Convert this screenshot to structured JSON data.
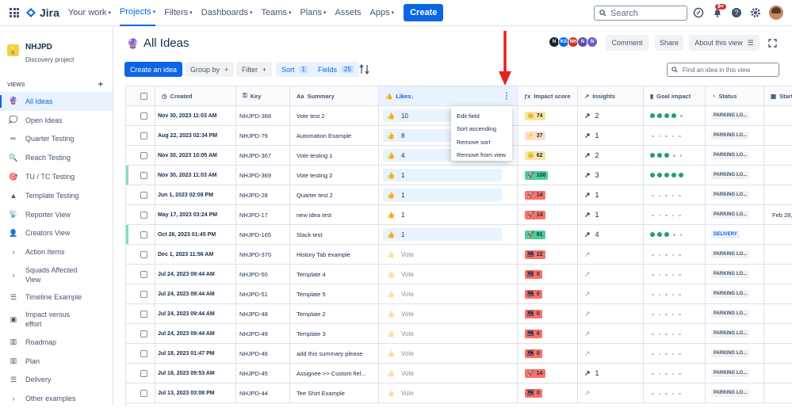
{
  "topnav": {
    "product": "Jira",
    "items": [
      {
        "label": "Your work",
        "dropdown": true
      },
      {
        "label": "Projects",
        "dropdown": true,
        "active": true
      },
      {
        "label": "Filters",
        "dropdown": true
      },
      {
        "label": "Dashboards",
        "dropdown": true
      },
      {
        "label": "Teams",
        "dropdown": true
      },
      {
        "label": "Plans",
        "dropdown": true
      },
      {
        "label": "Assets",
        "dropdown": false
      },
      {
        "label": "Apps",
        "dropdown": true
      }
    ],
    "create_label": "Create",
    "search_placeholder": "Search",
    "notifications_badge": "9+"
  },
  "sidebar": {
    "project_name": "NHJPD",
    "project_type": "Discovery project",
    "views_heading": "VIEWS",
    "items": [
      {
        "label": "All Ideas",
        "icon": "crystal-ball-icon",
        "glyph": "🔮",
        "active": true
      },
      {
        "label": "Open Ideas",
        "icon": "thought-icon",
        "glyph": "💭"
      },
      {
        "label": "Quarter Testing",
        "icon": "pencil-icon",
        "glyph": "✏"
      },
      {
        "label": "Reach Testing",
        "icon": "magnifier-icon",
        "glyph": "🔍"
      },
      {
        "label": "TU / TC Testing",
        "icon": "target-icon",
        "glyph": "🎯"
      },
      {
        "label": "Template Testing",
        "icon": "cone-icon",
        "glyph": "▲"
      },
      {
        "label": "Reporter View",
        "icon": "satellite-icon",
        "glyph": "📡"
      },
      {
        "label": "Creators View",
        "icon": "person-icon",
        "glyph": "👤"
      },
      {
        "label": "Action Items",
        "icon": "chevron-right-icon",
        "glyph": "›"
      },
      {
        "label": "Squads Affected View",
        "icon": "chevron-right-icon",
        "glyph": "›"
      },
      {
        "label": "Timeline Example",
        "icon": "timeline-icon",
        "glyph": "☰"
      },
      {
        "label": "Impact versus effort",
        "icon": "matrix-icon",
        "glyph": "▣"
      },
      {
        "label": "Roadmap",
        "icon": "board-icon",
        "glyph": "▥"
      },
      {
        "label": "Plan",
        "icon": "board-icon",
        "glyph": "▥"
      },
      {
        "label": "Delivery",
        "icon": "list-icon",
        "glyph": "☰"
      },
      {
        "label": "Other examples",
        "icon": "chevron-right-icon",
        "glyph": "›"
      }
    ]
  },
  "header": {
    "title": "All Ideas",
    "avatars": [
      {
        "initial": "N",
        "color": "#1d2125"
      },
      {
        "initial": "KS",
        "color": "#0c66e4"
      },
      {
        "initial": "NH",
        "color": "#c9372c"
      },
      {
        "initial": "N",
        "color": "#5e4db2"
      },
      {
        "initial": "N",
        "color": "#6e5dc6"
      }
    ],
    "comment_label": "Comment",
    "share_label": "Share",
    "about_label": "About this view"
  },
  "toolbar": {
    "create_idea": "Create an idea",
    "group_by": "Group by",
    "filter": "Filter",
    "sort": "Sort",
    "sort_count": "1",
    "fields": "Fields",
    "fields_count": "25",
    "find_placeholder": "Find an idea in this view"
  },
  "columns": [
    "Created",
    "Key",
    "Summary",
    "Likes",
    "Impact score",
    "Insights",
    "Goal impact",
    "Status",
    "Start"
  ],
  "rows": [
    {
      "created": "Nov 30, 2023 11:03 AM",
      "key": "NHJPD-368",
      "summary": "Vote test 2",
      "likes": "10",
      "liked": true,
      "impact": "74",
      "impact_icon": "👑",
      "impact_color": "#f8e6a0",
      "insights": "2",
      "goal": 4,
      "status": "PARKING LO...",
      "start": "",
      "marked": false
    },
    {
      "created": "Aug 22, 2023 02:34 PM",
      "key": "NHJPD-79",
      "summary": "Automation Example",
      "likes": "8",
      "liked": true,
      "impact": "37",
      "impact_icon": "⚡",
      "impact_color": "#fedec8",
      "insights": "1",
      "goal": 0,
      "status": "PARKING LO...",
      "start": "",
      "marked": false
    },
    {
      "created": "Nov 30, 2023 10:05 AM",
      "key": "NHJPD-367",
      "summary": "Vote testing 1",
      "likes": "4",
      "liked": true,
      "impact": "62",
      "impact_icon": "👑",
      "impact_color": "#f8e6a0",
      "insights": "2",
      "goal": 3,
      "status": "PARKING LO...",
      "start": "",
      "marked": false
    },
    {
      "created": "Nov 30, 2023 11:03 AM",
      "key": "NHJPD-369",
      "summary": "Vote testing 2",
      "likes": "1",
      "liked": true,
      "impact": "100",
      "impact_icon": "🚀",
      "impact_color": "#4bce97",
      "insights": "3",
      "goal": 5,
      "status": "PARKING LO...",
      "start": "",
      "marked": true
    },
    {
      "created": "Jun 1, 2023 02:08 PM",
      "key": "NHJPD-28",
      "summary": "Quarter test 2",
      "likes": "1",
      "liked": true,
      "impact": "14",
      "impact_icon": "🚀",
      "impact_color": "#f87168",
      "insights": "1",
      "goal": 0,
      "status": "PARKING LO...",
      "start": "",
      "marked": false
    },
    {
      "created": "May 17, 2023 03:24 PM",
      "key": "NHJPD-17",
      "summary": "new idea test",
      "likes": "1",
      "liked": false,
      "impact": "14",
      "impact_icon": "🚀",
      "impact_color": "#f87168",
      "insights": "1",
      "goal": 0,
      "status": "PARKING LO...",
      "start": "Feb 28,",
      "marked": false
    },
    {
      "created": "Oct 26, 2023 01:45 PM",
      "key": "NHJPD-165",
      "summary": "Slack test",
      "likes": "1",
      "liked": true,
      "impact": "91",
      "impact_icon": "🚀",
      "impact_color": "#4bce97",
      "insights": "4",
      "goal": 3,
      "status": "DELIVERY",
      "start": "",
      "marked": true
    },
    {
      "created": "Dec 1, 2023 11:56 AM",
      "key": "NHJPD-370",
      "summary": "History Tab example",
      "likes": "Vote",
      "liked": false,
      "impact": "22",
      "impact_icon": "🗺",
      "impact_color": "#f87168",
      "insights": "",
      "goal": 0,
      "status": "PARKING LO...",
      "start": "",
      "marked": false
    },
    {
      "created": "Jul 24, 2023 09:44 AM",
      "key": "NHJPD-50",
      "summary": "Template 4",
      "likes": "Vote",
      "liked": false,
      "impact": "0",
      "impact_icon": "🗺",
      "impact_color": "#f87168",
      "insights": "",
      "goal": 0,
      "status": "PARKING LO...",
      "start": "",
      "marked": false
    },
    {
      "created": "Jul 24, 2023 09:44 AM",
      "key": "NHJPD-51",
      "summary": "Template 5",
      "likes": "Vote",
      "liked": false,
      "impact": "0",
      "impact_icon": "🗺",
      "impact_color": "#f87168",
      "insights": "",
      "goal": 0,
      "status": "PARKING LO...",
      "start": "",
      "marked": false
    },
    {
      "created": "Jul 24, 2023 09:44 AM",
      "key": "NHJPD-48",
      "summary": "Template 2",
      "likes": "Vote",
      "liked": false,
      "impact": "0",
      "impact_icon": "🗺",
      "impact_color": "#f87168",
      "insights": "",
      "goal": 0,
      "status": "PARKING LO...",
      "start": "",
      "marked": false
    },
    {
      "created": "Jul 24, 2023 09:44 AM",
      "key": "NHJPD-49",
      "summary": "Template 3",
      "likes": "Vote",
      "liked": false,
      "impact": "0",
      "impact_icon": "🗺",
      "impact_color": "#f87168",
      "insights": "",
      "goal": 0,
      "status": "PARKING LO...",
      "start": "",
      "marked": false
    },
    {
      "created": "Jul 18, 2023 01:47 PM",
      "key": "NHJPD-46",
      "summary": "add this summary please",
      "likes": "Vote",
      "liked": false,
      "impact": "0",
      "impact_icon": "🗺",
      "impact_color": "#f87168",
      "insights": "",
      "goal": 0,
      "status": "PARKING LO...",
      "start": "",
      "marked": false
    },
    {
      "created": "Jul 18, 2023 09:53 AM",
      "key": "NHJPD-45",
      "summary": "Assignee >> Custom fiel...",
      "likes": "Vote",
      "liked": false,
      "impact": "14",
      "impact_icon": "🚀",
      "impact_color": "#f87168",
      "insights": "1",
      "goal": 0,
      "status": "PARKING LO...",
      "start": "",
      "marked": false
    },
    {
      "created": "Jul 13, 2023 03:08 PM",
      "key": "NHJPD-44",
      "summary": "Tee Shirt Example",
      "likes": "Vote",
      "liked": false,
      "impact": "0",
      "impact_icon": "🗺",
      "impact_color": "#f87168",
      "insights": "",
      "goal": 0,
      "status": "PARKING LO...",
      "start": "",
      "marked": false
    }
  ],
  "column_menu": [
    "Edit field",
    "Sort ascending",
    "Remove sort",
    "Remove from view"
  ],
  "colors": {
    "accent": "#0c66e4",
    "annotation_arrow": "#e2231a"
  }
}
